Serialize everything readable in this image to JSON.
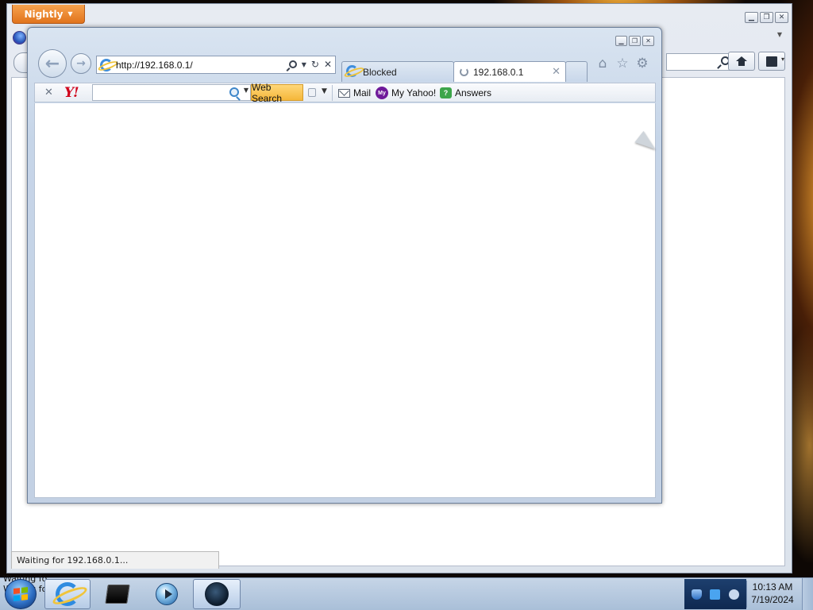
{
  "firefox": {
    "app_button_label": "Nightly",
    "status_text": "Waiting for 192.168.0.1..."
  },
  "ie": {
    "address_url": "http://192.168.0.1/",
    "tabs": [
      {
        "label": "Blocked",
        "state": "inactive"
      },
      {
        "label": "192.168.0.1",
        "state": "active-loading"
      }
    ],
    "toolbar_icons": [
      "home-icon",
      "favorites-star-icon",
      "tools-gear-icon"
    ]
  },
  "yahoo_toolbar": {
    "logo_text": "Y!",
    "search_value": "",
    "web_search_label": "Web Search",
    "links": [
      {
        "label": "Mail",
        "icon": "mail-icon"
      },
      {
        "label": "My Yahoo!",
        "icon": "my-yahoo-icon"
      },
      {
        "label": "Answers",
        "icon": "answers-icon"
      }
    ],
    "brand_color": "#d0011b",
    "search_button_color": "#f5b73a"
  },
  "taskbar": {
    "overlap_text_1": "Waiting fo",
    "overlap_text_2": "Waiting fo",
    "apps": [
      "internet-explorer",
      "server-app",
      "media-player",
      "globe-app"
    ],
    "clock_time": "10:13 AM",
    "clock_date": "7/19/2024"
  }
}
